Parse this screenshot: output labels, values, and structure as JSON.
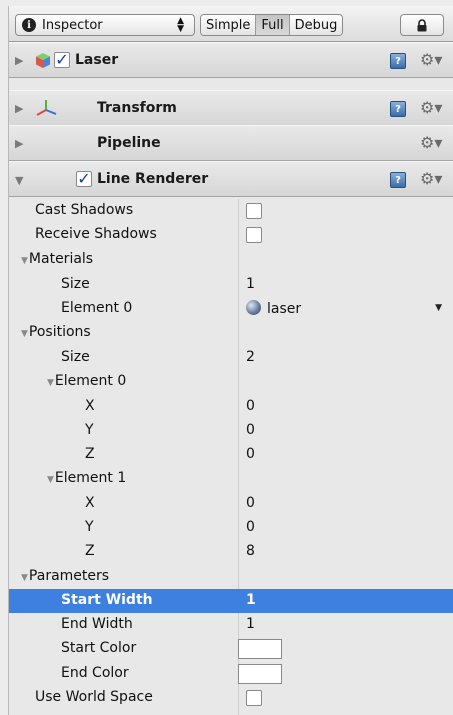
{
  "toolbar": {
    "dropdown_label": "Inspector",
    "modes": [
      "Simple",
      "Full",
      "Debug"
    ],
    "active_mode": "Full"
  },
  "components": {
    "laser": {
      "label": "Laser",
      "enabled": true
    },
    "transform": {
      "label": "Transform"
    },
    "pipeline": {
      "label": "Pipeline"
    },
    "line_renderer": {
      "label": "Line Renderer",
      "enabled": true
    }
  },
  "properties": {
    "cast_shadows": {
      "label": "Cast Shadows",
      "checked": false
    },
    "receive_shadows": {
      "label": "Receive Shadows",
      "checked": false
    },
    "materials": {
      "label": "Materials",
      "size_label": "Size",
      "size_value": "1",
      "element0_label": "Element 0",
      "element0_value": "laser"
    },
    "positions": {
      "label": "Positions",
      "size_label": "Size",
      "size_value": "2",
      "element0": {
        "label": "Element 0",
        "x_label": "X",
        "x": "0",
        "y_label": "Y",
        "y": "0",
        "z_label": "Z",
        "z": "0"
      },
      "element1": {
        "label": "Element 1",
        "x_label": "X",
        "x": "0",
        "y_label": "Y",
        "y": "0",
        "z_label": "Z",
        "z": "8"
      }
    },
    "parameters": {
      "label": "Parameters",
      "start_width_label": "Start Width",
      "start_width": "1",
      "end_width_label": "End Width",
      "end_width": "1",
      "start_color_label": "Start Color",
      "start_color": "#ffffff",
      "end_color_label": "End Color",
      "end_color": "#ffffff"
    },
    "use_world_space": {
      "label": "Use World Space",
      "checked": false
    }
  },
  "selected_row": "Start Width",
  "colors": {
    "selection": "#3d80df",
    "help_icon": "#3a6ea8"
  }
}
